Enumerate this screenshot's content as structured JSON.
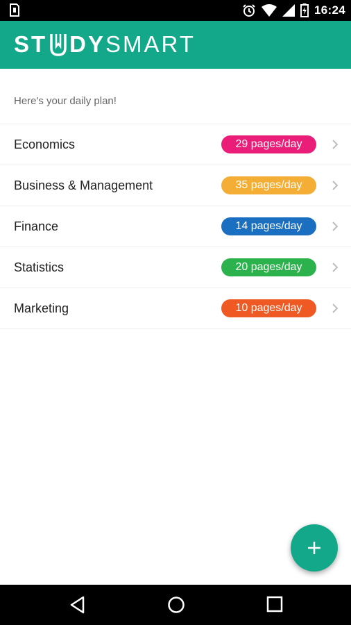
{
  "status_bar": {
    "time": "16:24",
    "icons": [
      "sim-card-icon",
      "alarm-icon",
      "wifi-icon",
      "signal-icon",
      "battery-icon"
    ]
  },
  "app": {
    "logo": {
      "part1": "ST",
      "part2": "DY",
      "part3": "SMART"
    },
    "accent_color": "#13a88a"
  },
  "plan": {
    "subtitle": "Here's your daily plan!",
    "items": [
      {
        "label": "Economics",
        "badge": "29 pages/day",
        "color": "#ea1e79"
      },
      {
        "label": "Business & Management",
        "badge": "35 pages/day",
        "color": "#f5ae35"
      },
      {
        "label": "Finance",
        "badge": "14 pages/day",
        "color": "#1a6fc0"
      },
      {
        "label": "Statistics",
        "badge": "20 pages/day",
        "color": "#2bb24c"
      },
      {
        "label": "Marketing",
        "badge": "10 pages/day",
        "color": "#ef5a24"
      }
    ]
  },
  "fab": {
    "icon": "plus-icon"
  },
  "nav_bar": {
    "icons": [
      "back-icon",
      "home-icon",
      "recents-icon"
    ]
  }
}
